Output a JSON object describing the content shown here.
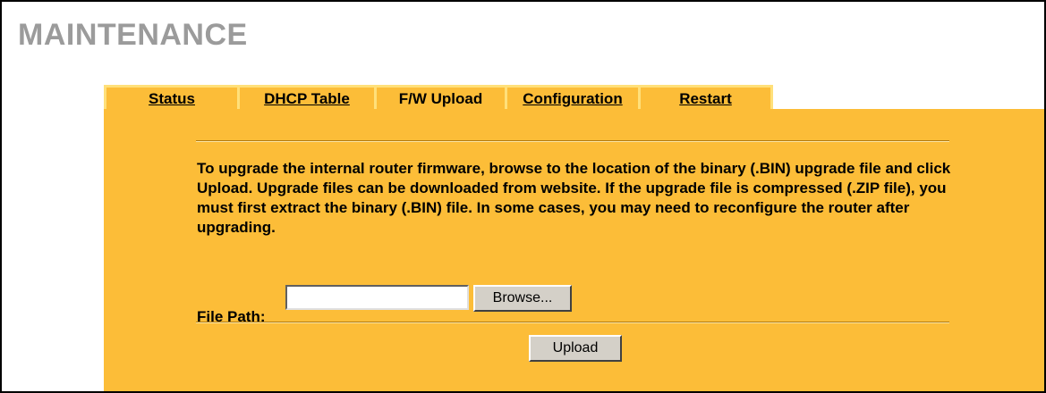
{
  "page": {
    "title": "MAINTENANCE"
  },
  "tabs": [
    {
      "label": "Status",
      "active": false
    },
    {
      "label": "DHCP Table",
      "active": false
    },
    {
      "label": "F/W Upload",
      "active": true
    },
    {
      "label": "Configuration",
      "active": false
    },
    {
      "label": "Restart",
      "active": false
    }
  ],
  "upload": {
    "description": "To upgrade the internal router firmware, browse to the location of the binary (.BIN) upgrade file and click Upload. Upgrade files can be downloaded from website. If the upgrade file is compressed (.ZIP file), you must first extract the binary (.BIN) file. In some cases, you may need to reconfigure the router after upgrading.",
    "file_path_label": "File Path:",
    "file_path_value": "",
    "browse_label": "Browse...",
    "upload_label": "Upload"
  },
  "colors": {
    "panel": "#fcbd38",
    "tab_border": "#ffe07a",
    "title": "#9b9b9b",
    "button_face": "#d4d0c8"
  }
}
